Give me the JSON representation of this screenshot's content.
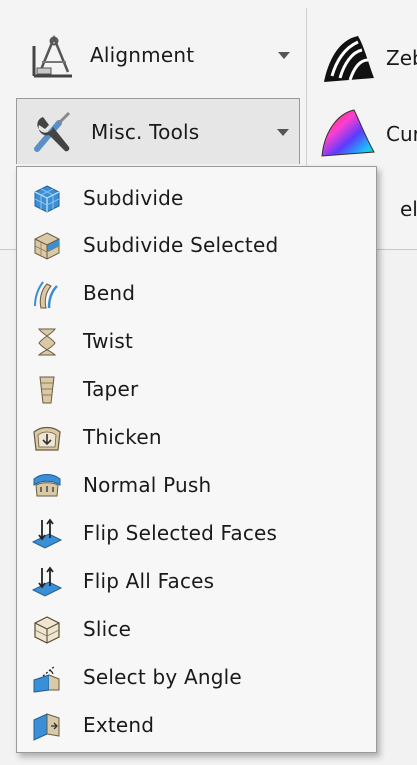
{
  "ribbon": {
    "alignment_label": "Alignment",
    "misc_tools_label": "Misc. Tools",
    "zebra_label": "Zeb",
    "curvature_label": "Cur",
    "peek_label": "el"
  },
  "menu": {
    "items": [
      {
        "label": "Subdivide",
        "icon": "subdivide-icon"
      },
      {
        "label": "Subdivide Selected",
        "icon": "subdivide-selected-icon"
      },
      {
        "label": "Bend",
        "icon": "bend-icon"
      },
      {
        "label": "Twist",
        "icon": "twist-icon"
      },
      {
        "label": "Taper",
        "icon": "taper-icon"
      },
      {
        "label": "Thicken",
        "icon": "thicken-icon"
      },
      {
        "label": "Normal Push",
        "icon": "normal-push-icon"
      },
      {
        "label": "Flip Selected Faces",
        "icon": "flip-selected-faces-icon"
      },
      {
        "label": "Flip All Faces",
        "icon": "flip-all-faces-icon"
      },
      {
        "label": "Slice",
        "icon": "slice-icon"
      },
      {
        "label": "Select by Angle",
        "icon": "select-by-angle-icon"
      },
      {
        "label": "Extend",
        "icon": "extend-icon"
      }
    ]
  },
  "colors": {
    "menu_bg": "#f7f7f7",
    "menu_border": "#9a9a9a",
    "icon_blue": "#3a8fd6",
    "icon_beige": "#d9c9a6"
  }
}
